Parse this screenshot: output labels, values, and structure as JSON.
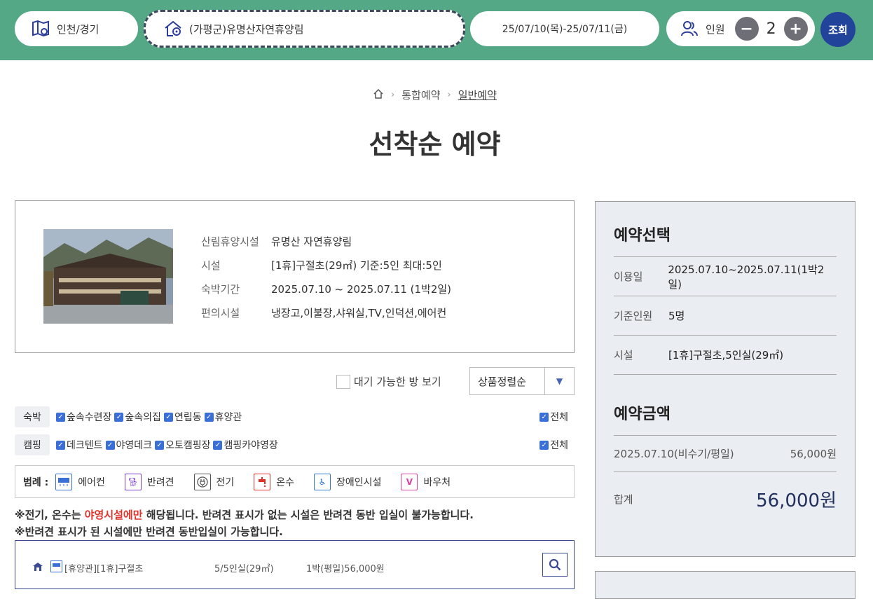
{
  "search": {
    "region": "인천/경기",
    "forest": "(가평군)유명산자연휴양림",
    "dates": "25/07/10(목)-25/07/11(금)",
    "people_label": "인원",
    "people_count": "2",
    "minus": "−",
    "plus": "+",
    "submit": "조회"
  },
  "breadcrumb": {
    "items": [
      "통합예약",
      "일반예약"
    ]
  },
  "page_title": "선착순 예약",
  "facility": {
    "rows": [
      {
        "key": "산림휴양시설",
        "value": "유명산 자연휴양림"
      },
      {
        "key": "시설",
        "value": "[1휴]구절초(29㎡) 기준:5인 최대:5인"
      },
      {
        "key": "숙박기간",
        "value": "2025.07.10 ~ 2025.07.11 (1박2일)"
      },
      {
        "key": "편의시설",
        "value": "냉장고,이불장,샤워실,TV,인덕션,에어컨"
      }
    ]
  },
  "filters": {
    "waiting_label": "대기 가능한 방 보기",
    "sort_value": "상품정렬순",
    "lodging": {
      "label": "숙박",
      "items": [
        "숲속수련장",
        "숲속의집",
        "연립동",
        "휴양관"
      ],
      "all": "전체"
    },
    "camping": {
      "label": "캠핑",
      "items": [
        "데크텐트",
        "야영데크",
        "오토캠핑장",
        "캠핑카야영장"
      ],
      "all": "전체"
    }
  },
  "legend": {
    "label": "범례 :",
    "items": [
      {
        "name": "에어컨",
        "color": "#3b6fd8"
      },
      {
        "name": "반려견",
        "color": "#7a3fd0"
      },
      {
        "name": "전기",
        "color": "#555555"
      },
      {
        "name": "온수",
        "color": "#e0312b"
      },
      {
        "name": "장애인시설",
        "color": "#2b7bd0"
      },
      {
        "name": "바우처",
        "color": "#d63fa0"
      }
    ]
  },
  "notice": {
    "line1_a": "※전기, 온수는 ",
    "line1_red": "야영시설에만",
    "line1_b": " 해당됩니다. 반려견 표시가 없는 시설은 반려견 동반 입실이 불가능합니다.",
    "line2": "※반려견 표시가 된 시설에만 반려견 동반입실이 가능합니다."
  },
  "result": {
    "name": "[휴양관][1휴]구절초",
    "capacity": "5/5인실(29㎡)",
    "price": "1박(평일)56,000원"
  },
  "side": {
    "select_title": "예약선택",
    "rows": [
      {
        "key": "이용일",
        "value": "2025.07.10~2025.07.11(1박2일)"
      },
      {
        "key": "기준인원",
        "value": "5명"
      },
      {
        "key": "시설",
        "value": "[1휴]구절초,5인실(29㎡)"
      }
    ],
    "price_title": "예약금액",
    "price_row": {
      "key": "2025.07.10(비수기/평일)",
      "value": "56,000원"
    },
    "total": {
      "key": "합계",
      "value": "56,000원"
    }
  }
}
